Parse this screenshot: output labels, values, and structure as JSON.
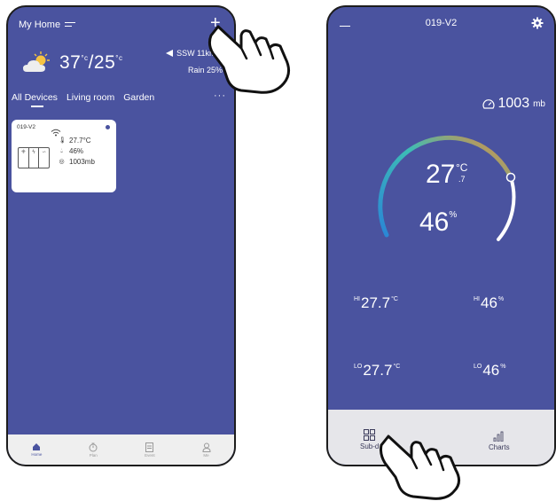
{
  "left_phone": {
    "header": {
      "title": "My Home"
    },
    "weather": {
      "temp_high": "37",
      "temp_low": "25",
      "unit": "°c",
      "wind": "SSW 11km/h",
      "rain": "Rain 25%"
    },
    "tabs": [
      {
        "label": "All Devices"
      },
      {
        "label": "Living room"
      },
      {
        "label": "Garden"
      }
    ],
    "tabs_more": "···",
    "device": {
      "name": "019-V2",
      "temperature": "27.7°C",
      "humidity": "46%",
      "pressure": "1003mb"
    },
    "nav": [
      {
        "label": "Home"
      },
      {
        "label": "Plan"
      },
      {
        "label": "Event"
      },
      {
        "label": "Me"
      }
    ]
  },
  "right_phone": {
    "title": "019-V2",
    "pressure_value": "1003",
    "pressure_unit": "mb",
    "temp_int": "27",
    "temp_unit": "°C",
    "temp_frac": ".7",
    "humidity": "46",
    "humidity_unit": "%",
    "hi_label": "HI",
    "lo_label": "LO",
    "hi_temp": "27.7",
    "lo_temp": "27.7",
    "temp_small_unit": "°C",
    "hi_hum": "46",
    "lo_hum": "46",
    "bottom": {
      "sub_label": "Sub-d",
      "charts_label": "Charts"
    }
  },
  "colors": {
    "screen_bg": "#4a539f",
    "gauge_start": "#2a86d6",
    "gauge_mid": "#3dbdb5",
    "gauge_end": "#e98a39"
  }
}
